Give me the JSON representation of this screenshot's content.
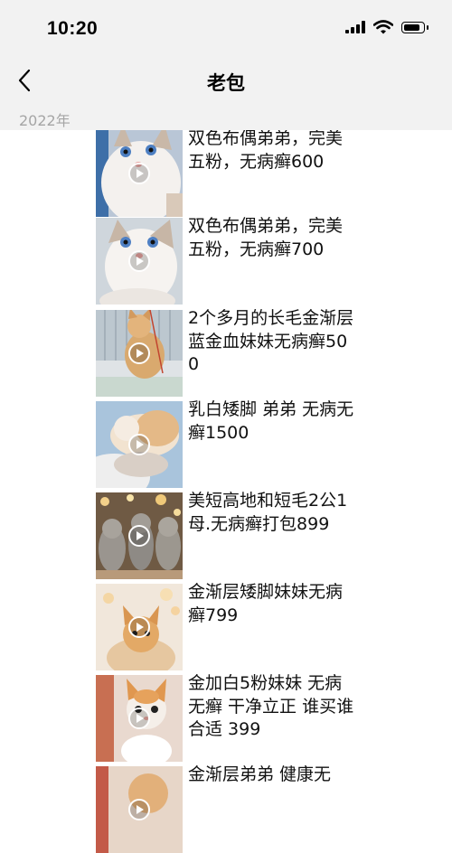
{
  "status": {
    "time": "10:20"
  },
  "nav": {
    "title": "老包"
  },
  "section": {
    "year": "2022年"
  },
  "items": [
    {
      "caption": "双色布偶弟弟，完美五粉，无病癣600",
      "icon": "play-icon"
    },
    {
      "caption": "双色布偶弟弟，完美五粉，无病癣700",
      "icon": "play-icon"
    },
    {
      "caption": "2个多月的长毛金渐层蓝金血妹妹无病癣500",
      "icon": "play-icon"
    },
    {
      "caption": "乳白矮脚 弟弟 无病无癣1500",
      "icon": "play-icon"
    },
    {
      "caption": "美短高地和短毛2公1母.无病癣打包899",
      "icon": "play-icon"
    },
    {
      "caption": "金渐层矮脚妹妹无病癣799",
      "icon": "play-icon"
    },
    {
      "caption": "金加白5粉妹妹 无病无癣 干净立正 谁买谁合适 399",
      "icon": "play-icon"
    },
    {
      "caption": "金渐层弟弟 健康无",
      "icon": "play-icon"
    }
  ]
}
